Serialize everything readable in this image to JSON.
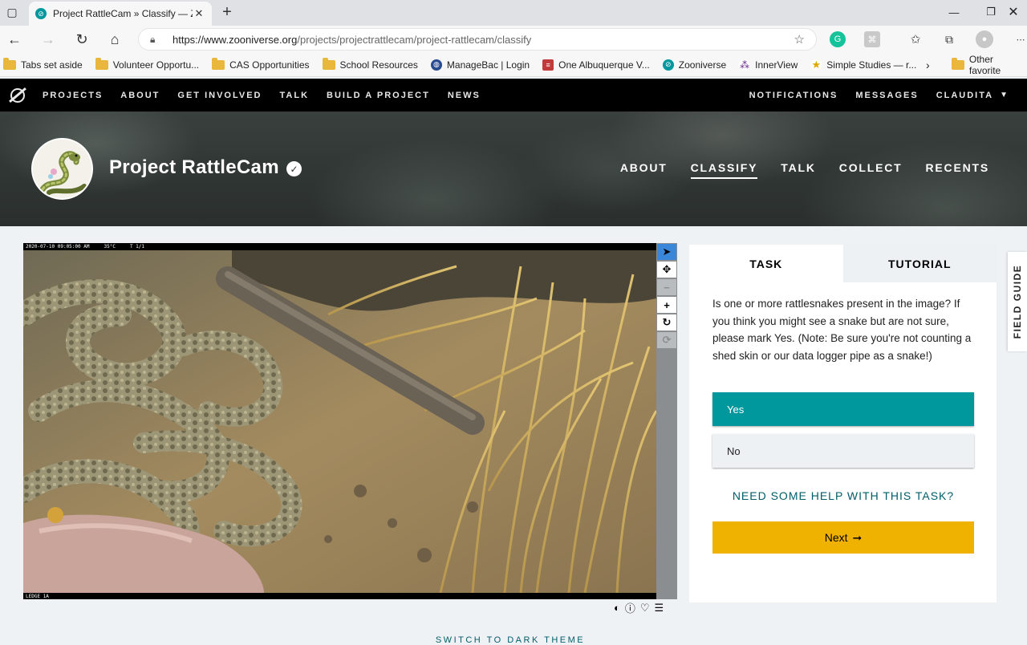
{
  "browser": {
    "tab_title": "Project RattleCam » Classify — Z",
    "url_host": "https://www.zooniverse.org",
    "url_path": "/projects/projectrattlecam/project-rattlecam/classify",
    "bookmarks": [
      {
        "label": "Tabs set aside",
        "icon": "folder-icon"
      },
      {
        "label": "Volunteer Opportu...",
        "icon": "folder-icon"
      },
      {
        "label": "CAS Opportunities",
        "icon": "folder-icon"
      },
      {
        "label": "School Resources",
        "icon": "folder-icon"
      },
      {
        "label": "ManageBac | Login",
        "icon": "globe-icon"
      },
      {
        "label": "One Albuquerque V...",
        "icon": "flag-icon"
      },
      {
        "label": "Zooniverse",
        "icon": "zooniverse-icon"
      },
      {
        "label": "InnerView",
        "icon": "innerview-icon"
      },
      {
        "label": "Simple Studies — r...",
        "icon": "star-icon"
      }
    ],
    "other_favorites": "Other favorite"
  },
  "site_nav": {
    "left": [
      "PROJECTS",
      "ABOUT",
      "GET INVOLVED",
      "TALK",
      "BUILD A PROJECT",
      "NEWS"
    ],
    "notifications": "NOTIFICATIONS",
    "messages": "MESSAGES",
    "user": "CLAUDITA"
  },
  "project": {
    "title": "Project RattleCam",
    "nav": [
      "ABOUT",
      "CLASSIFY",
      "TALK",
      "COLLECT",
      "RECENTS"
    ],
    "active_nav": "CLASSIFY"
  },
  "subject": {
    "timestamp": "2020-07-10 09:05:00 AM",
    "temperature": "35°C",
    "frame": "T 1/1",
    "location": "LEDGE 1A"
  },
  "task": {
    "tabs": [
      "TASK",
      "TUTORIAL"
    ],
    "question": "Is one or more rattlesnakes present in the image? If you think you might see a snake but are not sure, please mark Yes. (Note: Be sure you're not counting a shed skin or our data logger pipe as a snake!)",
    "answers": [
      "Yes",
      "No"
    ],
    "help": "NEED SOME HELP WITH THIS TASK?",
    "next": "Next"
  },
  "field_guide": "FIELD GUIDE",
  "dark_theme": "SWITCH TO DARK THEME",
  "colors": {
    "accent_teal": "#00979d",
    "next_yellow": "#f0b200",
    "link_teal": "#005d69",
    "nav_black": "#000000"
  }
}
